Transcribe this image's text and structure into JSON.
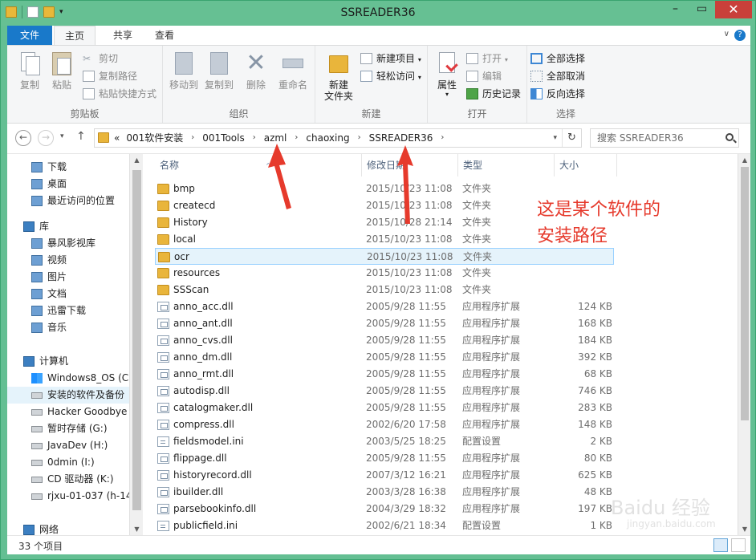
{
  "window": {
    "title": "SSREADER36"
  },
  "tabs": {
    "file": "文件",
    "home": "主页",
    "share": "共享",
    "view": "查看"
  },
  "help": "?",
  "ribbon": {
    "clipboard": {
      "label": "剪贴板",
      "copy": "复制",
      "paste": "粘贴",
      "cut": "剪切",
      "copy_path": "复制路径",
      "paste_shortcut": "粘贴快捷方式"
    },
    "organize": {
      "label": "组织",
      "move_to": "移动到",
      "copy_to": "复制到",
      "delete": "删除",
      "rename": "重命名"
    },
    "new": {
      "label": "新建",
      "new_folder": "新建\n文件夹",
      "new_item": "新建项目",
      "easy_access": "轻松访问"
    },
    "open": {
      "label": "打开",
      "properties": "属性",
      "open": "打开",
      "edit": "编辑",
      "history": "历史记录"
    },
    "select": {
      "label": "选择",
      "select_all": "全部选择",
      "select_none": "全部取消",
      "invert": "反向选择"
    }
  },
  "address": {
    "prefix": "«",
    "crumbs": [
      "001软件安装",
      "001Tools",
      "azml",
      "chaoxing",
      "SSREADER36"
    ],
    "search_placeholder": "搜索 SSREADER36"
  },
  "nav": {
    "items": [
      {
        "label": "下载",
        "icon": "download-icon"
      },
      {
        "label": "桌面",
        "icon": "desktop-icon"
      },
      {
        "label": "最近访问的位置",
        "icon": "recent-icon"
      },
      {
        "label": "库",
        "icon": "library-icon"
      },
      {
        "label": "暴风影视库",
        "icon": "video-library-icon"
      },
      {
        "label": "视频",
        "icon": "video-icon"
      },
      {
        "label": "图片",
        "icon": "picture-icon"
      },
      {
        "label": "文档",
        "icon": "document-icon"
      },
      {
        "label": "迅雷下载",
        "icon": "thunder-download-icon"
      },
      {
        "label": "音乐",
        "icon": "music-icon"
      },
      {
        "label": "计算机",
        "icon": "computer-icon"
      },
      {
        "label": "Windows8_OS (C",
        "icon": "windows-drive-icon"
      },
      {
        "label": "安装的软件及备份",
        "icon": "drive-icon"
      },
      {
        "label": "Hacker Goodbye",
        "icon": "drive-icon"
      },
      {
        "label": "暂时存储 (G:)",
        "icon": "drive-icon"
      },
      {
        "label": "JavaDev (H:)",
        "icon": "drive-icon"
      },
      {
        "label": "0dmin (I:)",
        "icon": "drive-icon"
      },
      {
        "label": "CD 驱动器 (K:)",
        "icon": "cd-drive-icon"
      },
      {
        "label": "rjxu-01-037 (h-14",
        "icon": "network-drive-icon"
      },
      {
        "label": "网络",
        "icon": "network-icon"
      }
    ]
  },
  "columns": {
    "name": "名称",
    "date": "修改日期",
    "type": "类型",
    "size": "大小"
  },
  "files": [
    {
      "name": "bmp",
      "date": "2015/10/23 11:08",
      "type": "文件夹",
      "size": "",
      "kind": "folder"
    },
    {
      "name": "createcd",
      "date": "2015/10/23 11:08",
      "type": "文件夹",
      "size": "",
      "kind": "folder"
    },
    {
      "name": "History",
      "date": "2015/10/28 21:14",
      "type": "文件夹",
      "size": "",
      "kind": "folder"
    },
    {
      "name": "local",
      "date": "2015/10/23 11:08",
      "type": "文件夹",
      "size": "",
      "kind": "folder"
    },
    {
      "name": "ocr",
      "date": "2015/10/23 11:08",
      "type": "文件夹",
      "size": "",
      "kind": "folder"
    },
    {
      "name": "resources",
      "date": "2015/10/23 11:08",
      "type": "文件夹",
      "size": "",
      "kind": "folder"
    },
    {
      "name": "SSScan",
      "date": "2015/10/23 11:08",
      "type": "文件夹",
      "size": "",
      "kind": "folder"
    },
    {
      "name": "anno_acc.dll",
      "date": "2005/9/28 11:55",
      "type": "应用程序扩展",
      "size": "124 KB",
      "kind": "dll"
    },
    {
      "name": "anno_ant.dll",
      "date": "2005/9/28 11:55",
      "type": "应用程序扩展",
      "size": "168 KB",
      "kind": "dll"
    },
    {
      "name": "anno_cvs.dll",
      "date": "2005/9/28 11:55",
      "type": "应用程序扩展",
      "size": "184 KB",
      "kind": "dll"
    },
    {
      "name": "anno_dm.dll",
      "date": "2005/9/28 11:55",
      "type": "应用程序扩展",
      "size": "392 KB",
      "kind": "dll"
    },
    {
      "name": "anno_rmt.dll",
      "date": "2005/9/28 11:55",
      "type": "应用程序扩展",
      "size": "68 KB",
      "kind": "dll"
    },
    {
      "name": "autodisp.dll",
      "date": "2005/9/28 11:55",
      "type": "应用程序扩展",
      "size": "746 KB",
      "kind": "dll"
    },
    {
      "name": "catalogmaker.dll",
      "date": "2005/9/28 11:55",
      "type": "应用程序扩展",
      "size": "283 KB",
      "kind": "dll"
    },
    {
      "name": "compress.dll",
      "date": "2002/6/20 17:58",
      "type": "应用程序扩展",
      "size": "148 KB",
      "kind": "dll"
    },
    {
      "name": "fieldsmodel.ini",
      "date": "2003/5/25 18:25",
      "type": "配置设置",
      "size": "2 KB",
      "kind": "ini"
    },
    {
      "name": "flippage.dll",
      "date": "2005/9/28 11:55",
      "type": "应用程序扩展",
      "size": "80 KB",
      "kind": "dll"
    },
    {
      "name": "historyrecord.dll",
      "date": "2007/3/12 16:21",
      "type": "应用程序扩展",
      "size": "625 KB",
      "kind": "dll"
    },
    {
      "name": "ibuilder.dll",
      "date": "2003/3/28 16:38",
      "type": "应用程序扩展",
      "size": "48 KB",
      "kind": "dll"
    },
    {
      "name": "parsebookinfo.dll",
      "date": "2004/3/29 18:32",
      "type": "应用程序扩展",
      "size": "197 KB",
      "kind": "dll"
    },
    {
      "name": "publicfield.ini",
      "date": "2002/6/21 18:34",
      "type": "配置设置",
      "size": "1 KB",
      "kind": "ini"
    }
  ],
  "selected_file": "ocr",
  "annotation": {
    "line1": "这是某个软件的",
    "line2": "安装路径"
  },
  "status": {
    "count": "33 个项目"
  },
  "watermark": {
    "brand": "Baidu 经验",
    "url": "jingyan.baidu.com"
  },
  "colors": {
    "titlebar": "#66c093",
    "file_tab": "#1979ca",
    "annotation": "#e63a2c",
    "selection": "#e5f3fb"
  }
}
